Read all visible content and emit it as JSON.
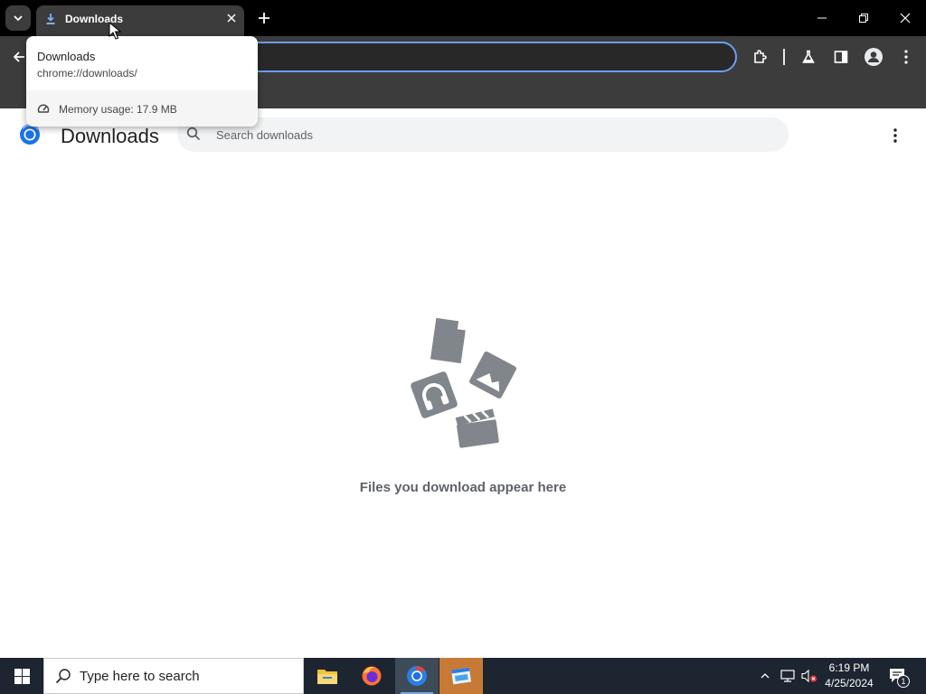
{
  "browser": {
    "tab": {
      "title": "Downloads",
      "favicon": "download-icon"
    },
    "hover_card": {
      "title": "Downloads",
      "url": "chrome://downloads/",
      "memory": "Memory usage: 17.9 MB"
    }
  },
  "page": {
    "title": "Downloads",
    "search_placeholder": "Search downloads",
    "empty_message": "Files you download appear here"
  },
  "taskbar": {
    "search_placeholder": "Type here to search",
    "time": "6:19 PM",
    "date": "4/25/2024",
    "notification_count": "1"
  },
  "colors": {
    "omnibox_focus": "#6f9cf3",
    "toolbar": "#3c3c3c",
    "illustration": "#80868b",
    "taskbar": "#1c2530"
  }
}
